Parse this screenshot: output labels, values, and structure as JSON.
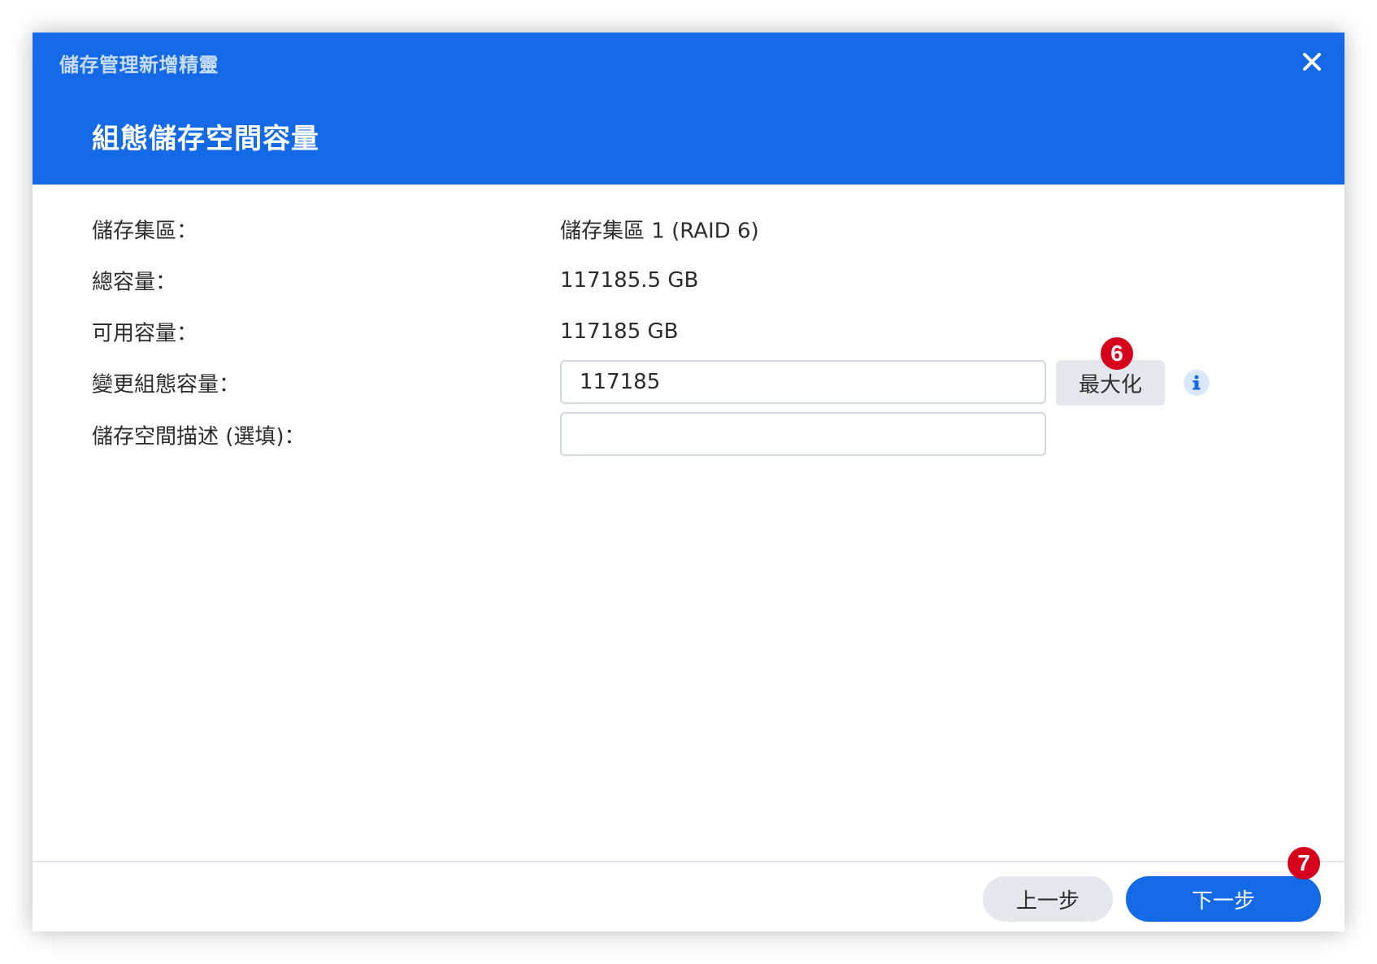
{
  "window": {
    "title": "儲存管理新增精靈",
    "close_icon": "close-icon"
  },
  "step": {
    "title": "組態儲存空間容量"
  },
  "form": {
    "storage_pool": {
      "label": "儲存集區：",
      "value": "儲存集區 1 (RAID 6)"
    },
    "total_capacity": {
      "label": "總容量：",
      "value": "117185.5 GB"
    },
    "available_capacity": {
      "label": "可用容量：",
      "value": "117185 GB"
    },
    "allocated_capacity": {
      "label": "變更組態容量：",
      "value": "117185",
      "max_button_label": "最大化",
      "info_icon": "info-icon"
    },
    "description": {
      "label": "儲存空間描述 (選填)：",
      "value": "",
      "placeholder": ""
    }
  },
  "annotations": {
    "badge_6": "6",
    "badge_7": "7"
  },
  "footer": {
    "prev_label": "上一步",
    "next_label": "下一步"
  },
  "colors": {
    "header": "#1369e6",
    "primary_button": "#1369e6",
    "secondary_button": "#e4e8ee",
    "badge": "#d6001c"
  }
}
